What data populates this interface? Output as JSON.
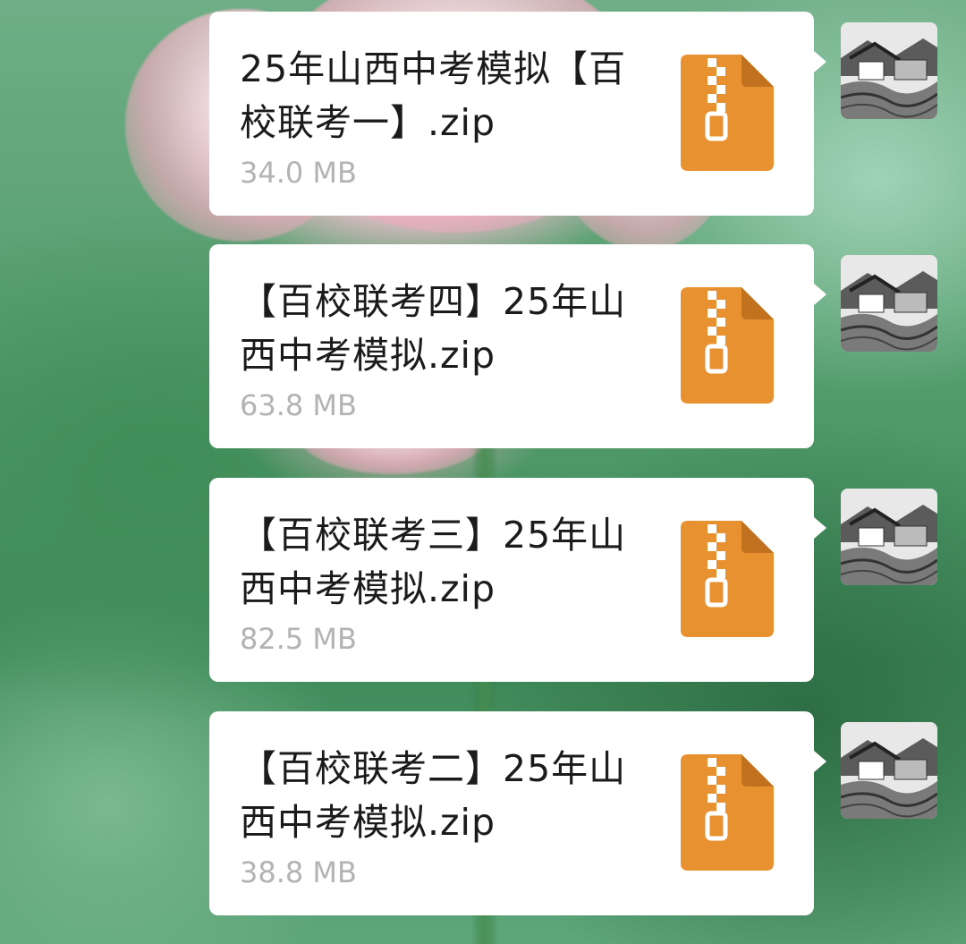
{
  "chat": {
    "messages": [
      {
        "file_name": "25年山西中考模拟【百校联考一】.zip",
        "file_size": "34.0 MB",
        "icon": "zip-file-icon"
      },
      {
        "file_name": "【百校联考四】25年山西中考模拟.zip",
        "file_size": "63.8 MB",
        "icon": "zip-file-icon"
      },
      {
        "file_name": "【百校联考三】25年山西中考模拟.zip",
        "file_size": "82.5 MB",
        "icon": "zip-file-icon"
      },
      {
        "file_name": "【百校联考二】25年山西中考模拟.zip",
        "file_size": "38.8 MB",
        "icon": "zip-file-icon"
      }
    ]
  },
  "colors": {
    "bubble": "#ffffff",
    "file_icon": "#e89131",
    "file_name_text": "#1b1b1b",
    "file_size_text": "#b3b3b3"
  }
}
